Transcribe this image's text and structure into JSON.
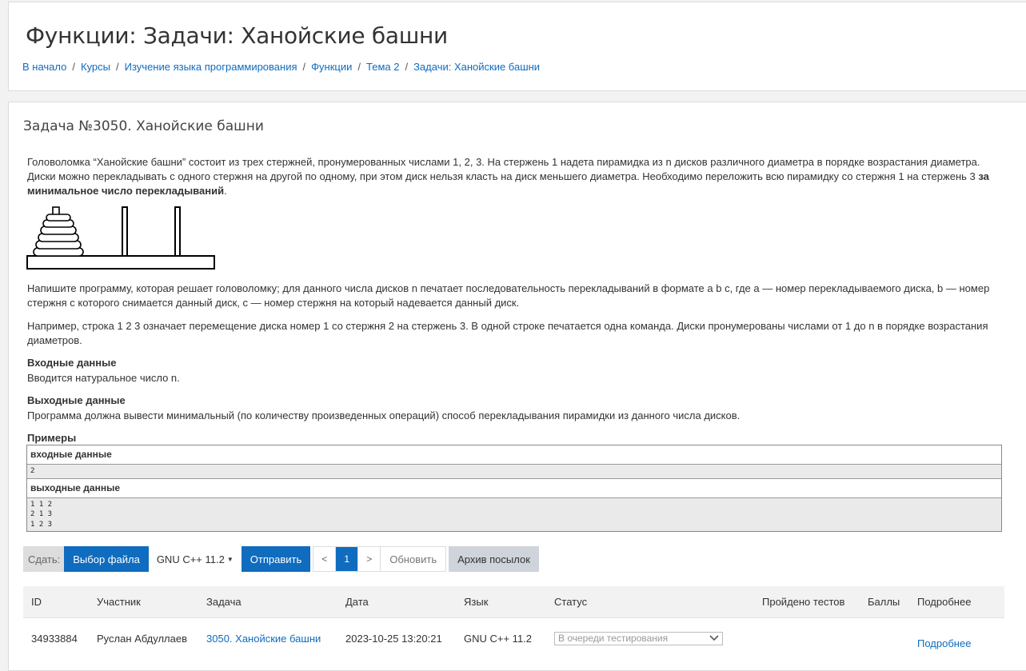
{
  "page": {
    "title": "Функции: Задачи: Ханойские башни",
    "breadcrumb": [
      "В начало",
      "Курсы",
      "Изучение языка программирования",
      "Функции",
      "Тема 2",
      "Задачи: Ханойские башни"
    ],
    "separator": "/"
  },
  "task": {
    "title": "Задача №3050. Ханойские башни",
    "statement_main": "Головоломка “Ханойские башни” состоит из трех стержней, пронумерованных числами 1, 2, 3. На стержень 1 надета пирамидка из n дисков различного диаметра в порядке возрастания диаметра. Диски можно перекладывать с одного стержня на другой по одному, при этом диск нельзя класть на диск меньшего диаметра. Необходимо переложить всю пирамидку со стержня 1 на стержень 3 ",
    "statement_bold": "за минимальное число перекладываний",
    "statement_end": ".",
    "output_format_desc": "Напишите программу, которая решает головоломку; для данного числа дисков n печатает последовательность перекладываний в формате a b c, где a — номер перекладываемого диска, b — номер стержня с которого снимается данный диск, c — номер стержня на который надевается данный диск.",
    "example_desc": "Например, строка 1 2 3 означает перемещение диска номер 1 со стержня 2 на стержень 3. В одной строке печатается одна команда. Диски пронумерованы числами от 1 до n в порядке возрастания диаметров.",
    "input_heading": "Входные данные",
    "input_text": "Вводится натуральное число n.",
    "output_heading": "Выходные данные",
    "output_text": "Программа должна вывести минимальный (по количеству произведенных операций) способ перекладывания пирамидки из данного числа дисков.",
    "examples_heading": "Примеры",
    "sample_input_label": "входные данные",
    "sample_input": "2",
    "sample_output_label": "выходные данные",
    "sample_output": "1 1 2\n2 1 3\n1 2 3"
  },
  "submit": {
    "label": "Сдать:",
    "choose_file": "Выбор файла",
    "language": "GNU C++ 11.2",
    "send": "Отправить",
    "prev": "<",
    "page": "1",
    "next": ">",
    "refresh": "Обновить",
    "archive": "Архив посылок"
  },
  "runs": {
    "headers": [
      "ID",
      "Участник",
      "Задача",
      "Дата",
      "Язык",
      "Статус",
      "Пройдено тестов",
      "Баллы",
      "Подробнее"
    ],
    "rows": [
      {
        "id": "34933884",
        "user": "Руслан Абдуллаев",
        "problem": "3050. Ханойские башни",
        "date": "2023-10-25 13:20:21",
        "lang": "GNU C++ 11.2",
        "status": "В очереди тестирования",
        "tests": "",
        "score": "",
        "details": "Подробнее"
      }
    ]
  },
  "icons": {
    "dropdown": "caret-down-icon",
    "status_select": "chevron-down-icon"
  },
  "colors": {
    "accent": "#0f6cbf",
    "page_bg": "#f2f2f2",
    "archive_bg": "#ced4da"
  }
}
